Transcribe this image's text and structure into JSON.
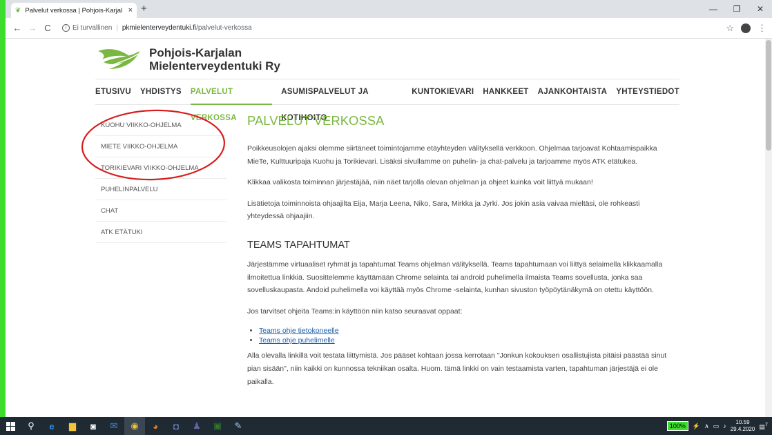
{
  "browser": {
    "tab_title": "Palvelut verkossa | Pohjois-Karjal",
    "tab_close": "×",
    "new_tab": "+",
    "security_label": "Ei turvallinen",
    "url_host": "pkmielenterveydentuki.fi",
    "url_path": "/palvelut-verkossa",
    "icons": {
      "back": "←",
      "forward": "→",
      "reload": "C",
      "star": "☆",
      "menu": "⋮",
      "minimize": "—",
      "maximize": "❐",
      "close": "✕"
    }
  },
  "site": {
    "logo_line1": "Pohjois-Karjalan",
    "logo_line2": "Mielenterveydentuki Ry",
    "nav": [
      {
        "label": "ETUSIVU",
        "active": false
      },
      {
        "label": "YHDISTYS",
        "active": false
      },
      {
        "label": "PALVELUT VERKOSSA",
        "active": true
      },
      {
        "label": "ASUMISPALVELUT JA KOTIHOITO",
        "active": false
      },
      {
        "label": "KUNTOKIEVARI",
        "active": false
      },
      {
        "label": "HANKKEET",
        "active": false
      },
      {
        "label": "AJANKOHTAISTA",
        "active": false
      },
      {
        "label": "YHTEYSTIEDOT",
        "active": false
      }
    ],
    "sidebar": [
      "KUOHU VIIKKO-OHJELMA",
      "MIETE VIIKKO-OHJELMA",
      "TORIKIEVARI VIIKKO-OHJELMA",
      "PUHELINPALVELU",
      "CHAT",
      "ATK ETÄTUKI"
    ],
    "accent_color": "#7bb842"
  },
  "content": {
    "title": "PALVELUT VERKOSSA",
    "p1": "Poikkeusolojen ajaksi olemme siirtäneet toimintojamme etäyhteyden välityksellä verkkoon. Ohjelmaa tarjoavat Kohtaamispaikka MieTe, Kulttuuripaja Kuohu ja Torikievari. Lisäksi sivullamme on puhelin- ja chat-palvelu ja tarjoamme myös ATK etätukea.",
    "p2": "Klikkaa valikosta toiminnan järjestäjää, niin näet tarjolla olevan ohjelman ja ohjeet kuinka voit liittyä mukaan!",
    "p3": "Lisätietoja toiminnoista ohjaajilta Eija, Marja Leena, Niko, Sara, Mirkka ja Jyrki. Jos jokin asia vaivaa mieltäsi, ole rohkeasti yhteydessä ohjaajiin.",
    "h2": "TEAMS TAPAHTUMAT",
    "p4": "Järjestämme virtuaaliset ryhmät ja tapahtumat Teams ohjelman välityksellä. Teams tapahtumaan voi liittyä selaimella klikkaamalla ilmoitettua linkkiä. Suosittelemme käyttämään Chrome selainta tai android puhelimella ilmaista Teams sovellusta, jonka saa sovelluskaupasta. Andoid puhelimella voi käyttää myös Chrome -selainta, kunhan sivuston työpöytänäkymä on otettu käyttöön.",
    "p5": "Jos tarvitset ohjeita Teams:in käyttöön niin katso seuraavat oppaat:",
    "links": [
      "Teams ohje tietokoneelle",
      "Teams ohje puhelimelle"
    ],
    "p6": "Alla olevalla linkillä voit testata liittymistä. Jos pääset kohtaan jossa kerrotaan \"Jonkun kokouksen osallistujista pitäisi päästää sinut pian sisään\", niin kaikki on kunnossa tekniikan osalta. Huom. tämä linkki on vain testaamista varten, tapahtuman järjestäjä ei ole paikalla."
  },
  "taskbar": {
    "battery": "100%",
    "time": "10.59",
    "date": "29.4.2020",
    "notification_count": "7"
  }
}
